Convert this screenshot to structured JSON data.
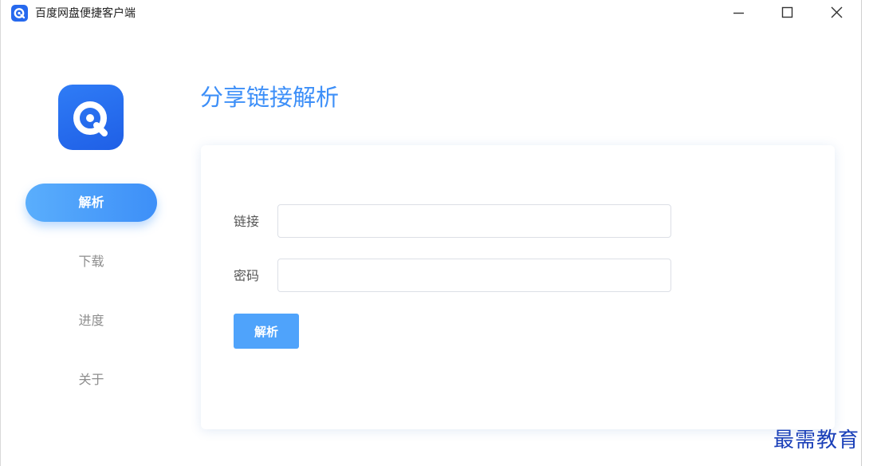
{
  "window": {
    "title": "百度网盘便捷客户端"
  },
  "sidebar": {
    "items": [
      {
        "label": "解析",
        "active": true
      },
      {
        "label": "下载",
        "active": false
      },
      {
        "label": "进度",
        "active": false
      },
      {
        "label": "关于",
        "active": false
      }
    ]
  },
  "main": {
    "page_title": "分享链接解析",
    "form": {
      "link_label": "链接",
      "link_value": "",
      "password_label": "密码",
      "password_value": "",
      "submit_label": "解析"
    }
  },
  "watermark": "最需教育",
  "icons": {
    "app": "app-logo-icon",
    "minimize": "minimize-icon",
    "maximize": "maximize-icon",
    "close": "close-icon"
  },
  "colors": {
    "accent": "#3d8ff8",
    "button": "#4fa3fb",
    "logo": "#2669ee",
    "watermark": "#1a3fb8"
  }
}
